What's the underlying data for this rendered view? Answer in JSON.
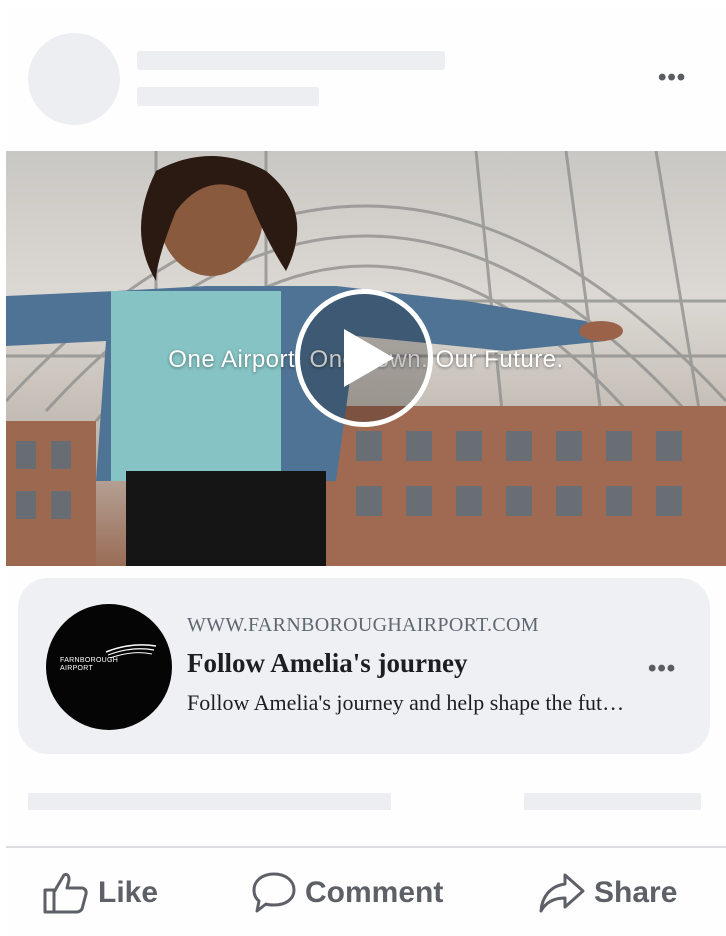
{
  "post": {
    "header": {
      "more_icon": "more-horizontal-icon"
    },
    "video": {
      "caption": "One Airport. One Town. Our Future.",
      "play_icon": "play-icon"
    },
    "link_preview": {
      "logo_lines": [
        "FARNBOROUGH",
        "AIRPORT"
      ],
      "url": "WWW.FARNBOROUGHAIRPORT.COM",
      "title": "Follow Amelia's journey",
      "description": "Follow Amelia's journey and help shape the future",
      "more_icon": "more-horizontal-icon"
    },
    "actions": [
      {
        "label": "Like",
        "icon": "thumbs-up-icon"
      },
      {
        "label": "Comment",
        "icon": "comment-icon"
      },
      {
        "label": "Share",
        "icon": "share-icon"
      }
    ]
  },
  "colors": {
    "placeholder": "#eceef2",
    "link_bg": "#eff0f4",
    "action_text": "#5d6066",
    "logo_bg": "#050505"
  }
}
